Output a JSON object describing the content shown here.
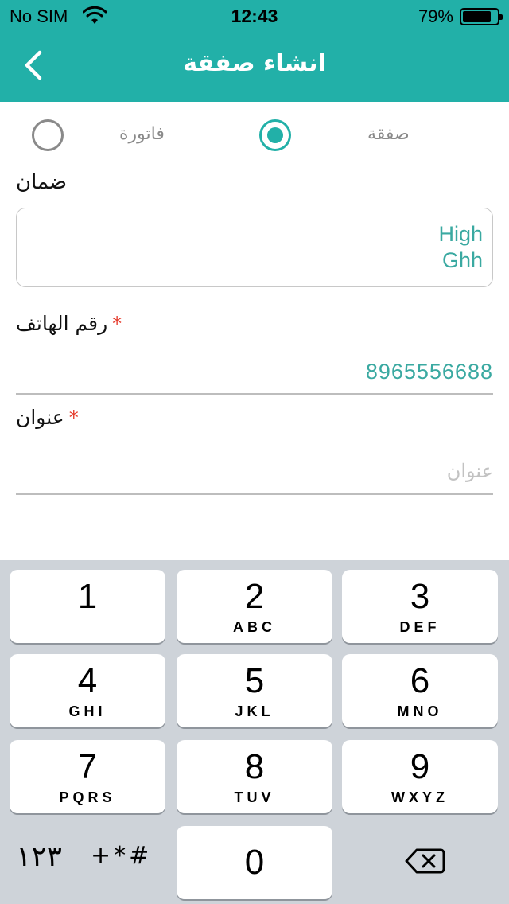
{
  "status_bar": {
    "carrier": "No SIM",
    "time": "12:43",
    "battery_percent": "79%",
    "battery_level": 0.79,
    "wifi_icon": "wifi-icon"
  },
  "header": {
    "title": "انشاء صفقة",
    "back_icon": "chevron-left-icon",
    "background_color": "#22b0a8"
  },
  "type_selector": {
    "options": [
      {
        "label": "صفقة",
        "selected": true
      },
      {
        "label": "فاتورة",
        "selected": false
      }
    ],
    "accent_color": "#22b0a8"
  },
  "form": {
    "partial_label": "ضمان",
    "notes_value": "High\nGhh",
    "phone": {
      "label": "رقم الهاتف",
      "required_mark": "*",
      "value": "8965556688"
    },
    "address": {
      "label": "عنوان",
      "required_mark": "*",
      "placeholder": "عنوان"
    }
  },
  "keypad": {
    "keys": [
      {
        "digit": "1",
        "letters": ""
      },
      {
        "digit": "2",
        "letters": "ABC"
      },
      {
        "digit": "3",
        "letters": "DEF"
      },
      {
        "digit": "4",
        "letters": "GHI"
      },
      {
        "digit": "5",
        "letters": "JKL"
      },
      {
        "digit": "6",
        "letters": "MNO"
      },
      {
        "digit": "7",
        "letters": "PQRS"
      },
      {
        "digit": "8",
        "letters": "TUV"
      },
      {
        "digit": "9",
        "letters": "WXYZ"
      },
      {
        "digit": "0",
        "letters": ""
      }
    ],
    "mode_label": "١٢٣",
    "symbols_label": "+*#",
    "delete_icon": "backspace-icon"
  }
}
